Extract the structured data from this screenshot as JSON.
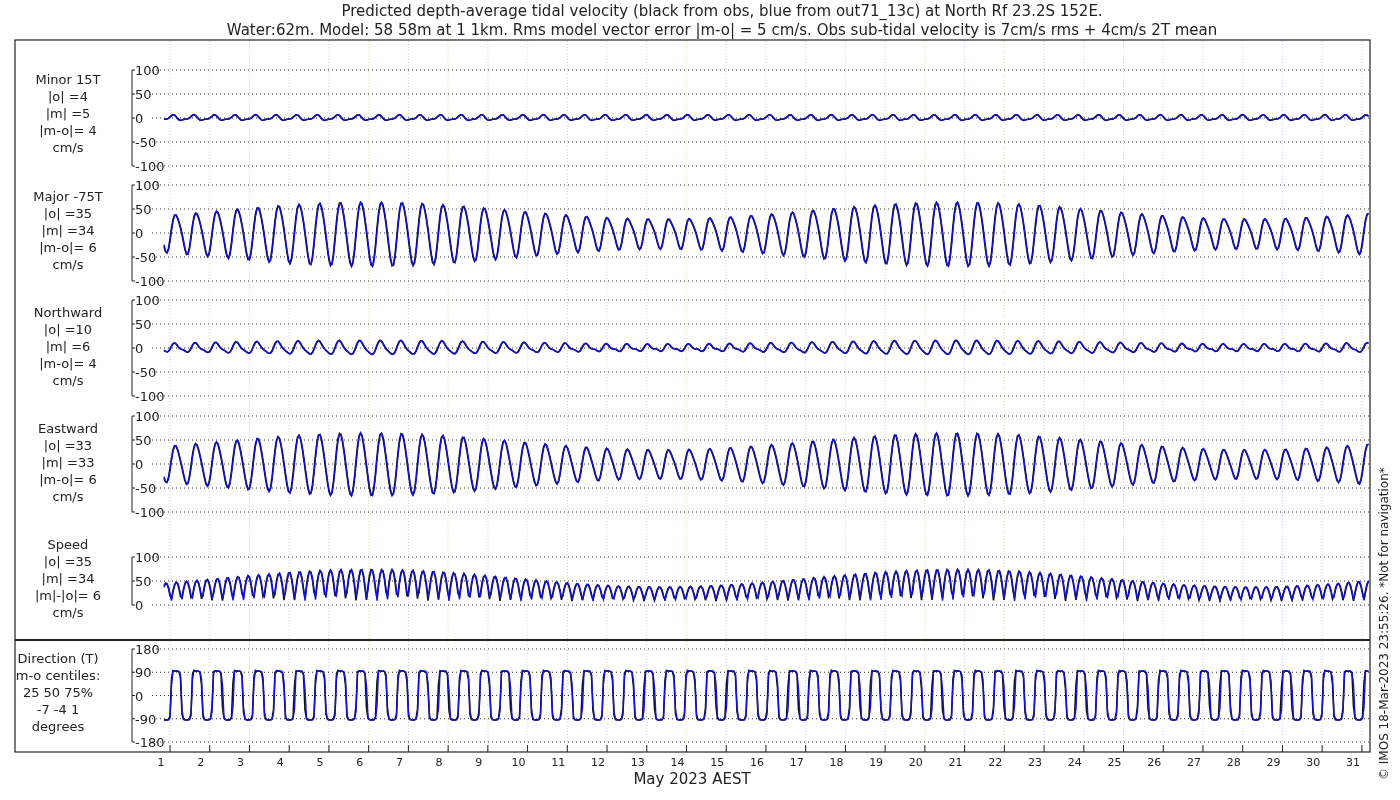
{
  "title": [
    "Predicted depth-average tidal velocity (black from obs, blue from out71_13c) at North Rf 23.2S 152E.",
    "Water:62m. Model: 58 58m at 1 1km. Rms model vector error |m-o| = 5 cm/s. Obs sub-tidal velocity is 7cm/s rms + 4cm/s 2T mean"
  ],
  "panels": [
    {
      "kind": "minor",
      "label_lines": [
        "Minor 15T",
        "|o| =4",
        "|m| =5",
        "|m-o|= 4",
        "cm/s"
      ],
      "yticks": [
        "100",
        "50",
        "0",
        "-50",
        "-100"
      ]
    },
    {
      "kind": "major",
      "label_lines": [
        "Major -75T",
        "|o| =35",
        "|m| =34",
        "|m-o|= 6",
        "cm/s"
      ],
      "yticks": [
        "100",
        "50",
        "0",
        "-50",
        "-100"
      ]
    },
    {
      "kind": "north",
      "label_lines": [
        "Northward",
        "|o| =10",
        "|m| =6",
        "|m-o|= 4",
        "cm/s"
      ],
      "yticks": [
        "100",
        "50",
        "0",
        "-50",
        "-100"
      ]
    },
    {
      "kind": "east",
      "label_lines": [
        "Eastward",
        "|o| =33",
        "|m| =33",
        "|m-o|= 6",
        "cm/s"
      ],
      "yticks": [
        "100",
        "50",
        "0",
        "-50",
        "-100"
      ]
    },
    {
      "kind": "speed",
      "label_lines": [
        "Speed",
        "|o| =35",
        "|m| =34",
        "|m|-|o|= 6",
        "cm/s"
      ],
      "yticks": [
        "100",
        "50",
        "0"
      ]
    },
    {
      "kind": "direction",
      "label_lines": [
        "Direction (T)",
        "m-o centiles:",
        "25  50  75%",
        "-7 -4  1",
        "degrees"
      ],
      "yticks": [
        "180",
        "90",
        "0",
        "-90",
        "-180"
      ]
    }
  ],
  "days": [
    "1",
    "2",
    "3",
    "4",
    "5",
    "6",
    "7",
    "8",
    "9",
    "10",
    "11",
    "12",
    "13",
    "14",
    "15",
    "16",
    "17",
    "18",
    "19",
    "20",
    "21",
    "22",
    "23",
    "24",
    "25",
    "26",
    "27",
    "28",
    "29",
    "30",
    "31"
  ],
  "xlabel": "May 2023 AEST",
  "credit": "© IMOS 18-Mar-2023 23:55:26. *Not for navigation*"
}
